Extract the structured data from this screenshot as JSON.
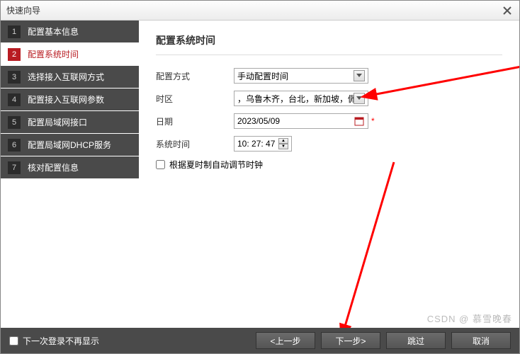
{
  "dialog": {
    "title": "快速向导"
  },
  "sidebar": {
    "items": [
      {
        "num": "1",
        "label": "配置基本信息"
      },
      {
        "num": "2",
        "label": "配置系统时间"
      },
      {
        "num": "3",
        "label": "选择接入互联网方式"
      },
      {
        "num": "4",
        "label": "配置接入互联网参数"
      },
      {
        "num": "5",
        "label": "配置局域网接口"
      },
      {
        "num": "6",
        "label": "配置局域网DHCP服务"
      },
      {
        "num": "7",
        "label": "核对配置信息"
      }
    ]
  },
  "page": {
    "title": "配置系统时间",
    "labels": {
      "method": "配置方式",
      "timezone": "时区",
      "date": "日期",
      "systime": "系统时间",
      "autoadjust": "根据夏时制自动调节时钟"
    },
    "values": {
      "method": "手动配置时间",
      "timezone": "，乌鲁木齐，台北，新加坡，佩思",
      "date": "2023/05/09",
      "systime": "10: 27: 47"
    }
  },
  "footer": {
    "dontshow": "下一次登录不再显示",
    "prev": "<上一步",
    "next": "下一步>",
    "skip": "跳过",
    "cancel": "取消"
  },
  "watermark": "CSDN @ 慕雪晚春"
}
